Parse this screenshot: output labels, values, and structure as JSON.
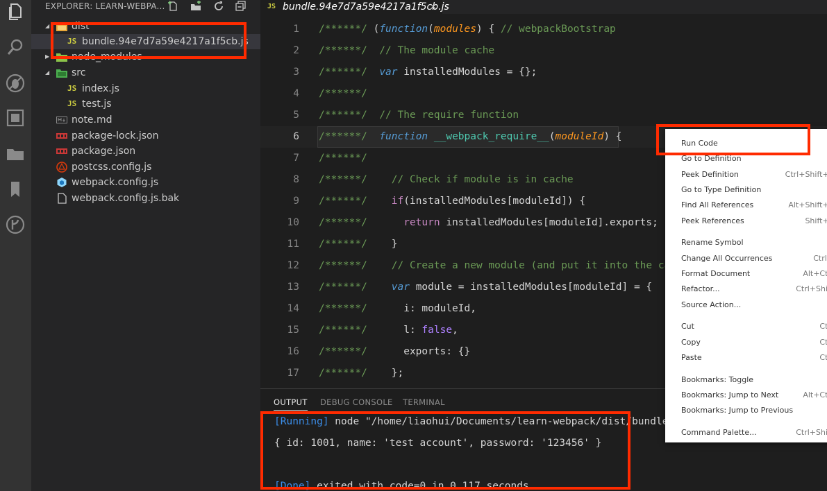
{
  "colors": {
    "accent_red": "#ff2b00",
    "activity_bar": "#333333",
    "sidebar": "#252526",
    "editor_bg": "#1e1e1e"
  },
  "activity_bar": {
    "icons": [
      "files-icon",
      "search-icon",
      "debug-icon",
      "extensions-icon",
      "folder-icon",
      "bookmark-icon",
      "git-icon"
    ]
  },
  "explorer": {
    "title": "EXPLORER: LEARN-WEBPA...",
    "actions": [
      "new-file-icon",
      "new-folder-icon",
      "refresh-icon",
      "collapse-all-icon"
    ],
    "tree": [
      {
        "label": "dist",
        "type": "folder",
        "expanded": true
      },
      {
        "label": "bundle.94e7d7a59e4217a1f5cb.js",
        "type": "js",
        "selected": true
      },
      {
        "label": "node_modules",
        "type": "folder",
        "expanded": false
      },
      {
        "label": "src",
        "type": "folder",
        "expanded": true
      },
      {
        "label": "index.js",
        "type": "js"
      },
      {
        "label": "test.js",
        "type": "js"
      },
      {
        "label": "note.md",
        "type": "markdown"
      },
      {
        "label": "package-lock.json",
        "type": "npm"
      },
      {
        "label": "package.json",
        "type": "npm"
      },
      {
        "label": "postcss.config.js",
        "type": "postcss"
      },
      {
        "label": "webpack.config.js",
        "type": "webpack"
      },
      {
        "label": "webpack.config.js.bak",
        "type": "file"
      }
    ]
  },
  "tab": {
    "badge": "JS",
    "title": "bundle.94e7d7a59e4217a1f5cb.js",
    "close": "×"
  },
  "editor": {
    "current_line": 6,
    "lines": [
      {
        "n": "1",
        "segs": [
          [
            "c-cmt",
            "/******/ "
          ],
          [
            "c-p",
            "("
          ],
          [
            "c-kw",
            "function"
          ],
          [
            "c-p",
            "("
          ],
          [
            "c-param",
            "modules"
          ],
          [
            "c-p",
            ") { "
          ],
          [
            "c-cmt",
            "// webpackBootstrap"
          ]
        ]
      },
      {
        "n": "2",
        "segs": [
          [
            "c-cmt",
            "/******/  // The module cache"
          ]
        ]
      },
      {
        "n": "3",
        "segs": [
          [
            "c-cmt",
            "/******/  "
          ],
          [
            "c-kw",
            "var"
          ],
          [
            "c-p",
            " installedModules = {};"
          ]
        ]
      },
      {
        "n": "4",
        "segs": [
          [
            "c-cmt",
            "/******/"
          ]
        ]
      },
      {
        "n": "5",
        "segs": [
          [
            "c-cmt",
            "/******/  // The require function"
          ]
        ]
      },
      {
        "n": "6",
        "segs": [
          [
            "c-cmt",
            "/******/  "
          ],
          [
            "c-kw",
            "function"
          ],
          [
            "c-p",
            " "
          ],
          [
            "c-fn",
            "__webpack_require__"
          ],
          [
            "c-p",
            "("
          ],
          [
            "c-param",
            "moduleId"
          ],
          [
            "c-p",
            ") {"
          ]
        ]
      },
      {
        "n": "7",
        "segs": [
          [
            "c-cmt",
            "/******/"
          ]
        ]
      },
      {
        "n": "8",
        "segs": [
          [
            "c-cmt",
            "/******/    // Check if module is in cache"
          ]
        ]
      },
      {
        "n": "9",
        "segs": [
          [
            "c-cmt",
            "/******/    "
          ],
          [
            "c-ctl",
            "if"
          ],
          [
            "c-p",
            "(installedModules[moduleId]) {"
          ]
        ]
      },
      {
        "n": "10",
        "segs": [
          [
            "c-cmt",
            "/******/      "
          ],
          [
            "c-ctl",
            "return"
          ],
          [
            "c-p",
            " installedModules[moduleId].exports;"
          ]
        ]
      },
      {
        "n": "11",
        "segs": [
          [
            "c-cmt",
            "/******/    "
          ],
          [
            "c-p",
            "}"
          ]
        ]
      },
      {
        "n": "12",
        "segs": [
          [
            "c-cmt",
            "/******/    // Create a new module (and put it into the ca"
          ]
        ]
      },
      {
        "n": "13",
        "segs": [
          [
            "c-cmt",
            "/******/    "
          ],
          [
            "c-kw",
            "var"
          ],
          [
            "c-p",
            " module = installedModules[moduleId] = {"
          ]
        ]
      },
      {
        "n": "14",
        "segs": [
          [
            "c-cmt",
            "/******/      "
          ],
          [
            "c-p",
            "i: moduleId,"
          ]
        ]
      },
      {
        "n": "15",
        "segs": [
          [
            "c-cmt",
            "/******/      "
          ],
          [
            "c-p",
            "l: "
          ],
          [
            "c-bool",
            "false"
          ],
          [
            "c-p",
            ","
          ]
        ]
      },
      {
        "n": "16",
        "segs": [
          [
            "c-cmt",
            "/******/      "
          ],
          [
            "c-p",
            "exports: {}"
          ]
        ]
      },
      {
        "n": "17",
        "segs": [
          [
            "c-cmt",
            "/******/    "
          ],
          [
            "c-p",
            "};"
          ]
        ]
      }
    ]
  },
  "panel": {
    "tabs": [
      "OUTPUT",
      "DEBUG CONSOLE",
      "TERMINAL"
    ],
    "active_tab": "OUTPUT",
    "output": [
      {
        "tag": "[Running]",
        "text": " node \"/home/liaohui/Documents/learn-webpack/dist/bundle"
      },
      {
        "tag": "",
        "text": "{ id: 1001, name: 'test account', password: '123456' }"
      },
      {
        "tag": "",
        "text": ""
      },
      {
        "tag": "[Done]",
        "text": " exited with code=0 in 0.117 seconds"
      }
    ]
  },
  "context_menu": {
    "items": [
      {
        "label": "Run Code",
        "key": ""
      },
      {
        "label": "Go to Definition",
        "key": "F"
      },
      {
        "label": "Peek Definition",
        "key": "Ctrl+Shift+F"
      },
      {
        "label": "Go to Type Definition",
        "key": ""
      },
      {
        "label": "Find All References",
        "key": "Alt+Shift+F"
      },
      {
        "label": "Peek References",
        "key": "Shift+F"
      },
      {
        "sep": true
      },
      {
        "label": "Rename Symbol",
        "key": ""
      },
      {
        "label": "Change All Occurrences",
        "key": "Ctrl+"
      },
      {
        "label": "Format Document",
        "key": "Alt+Ctrl"
      },
      {
        "label": "Refactor...",
        "key": "Ctrl+Shift"
      },
      {
        "label": "Source Action...",
        "key": ""
      },
      {
        "sep": true
      },
      {
        "label": "Cut",
        "key": "Ctrl"
      },
      {
        "label": "Copy",
        "key": "Ctrl"
      },
      {
        "label": "Paste",
        "key": "Ctrl"
      },
      {
        "sep": true
      },
      {
        "label": "Bookmarks: Toggle",
        "key": ""
      },
      {
        "label": "Bookmarks: Jump to Next",
        "key": "Alt+Ctrl"
      },
      {
        "label": "Bookmarks: Jump to Previous",
        "key": ""
      },
      {
        "sep": true
      },
      {
        "label": "Command Palette...",
        "key": "Ctrl+Shift"
      }
    ]
  }
}
